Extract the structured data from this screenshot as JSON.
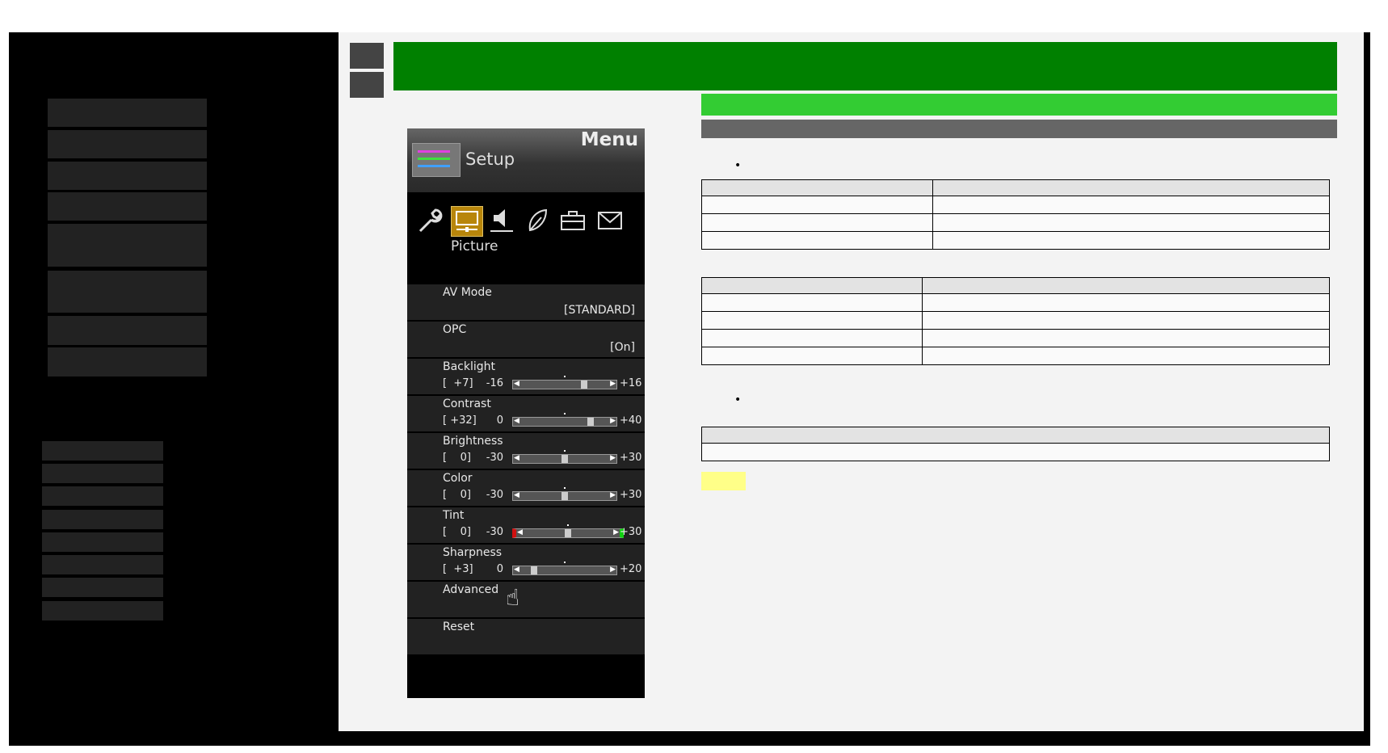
{
  "tv_menu": {
    "menu_label": "Menu",
    "setup_label": "Setup",
    "category_label": "Picture",
    "category_icons": [
      "wrench-icon",
      "picture-icon",
      "speaker-icon",
      "leaf-icon",
      "briefcase-icon",
      "mail-icon"
    ],
    "items": [
      {
        "label": "AV Mode",
        "value": "[STANDARD]"
      },
      {
        "label": "OPC",
        "value": "[On]"
      },
      {
        "label": "Backlight",
        "current": "+7",
        "min": "-16",
        "max": "+16",
        "level": 0.72
      },
      {
        "label": "Contrast",
        "current": "+32",
        "min": "0",
        "max": "+40",
        "level": 0.8
      },
      {
        "label": "Brightness",
        "current": "0",
        "min": "-30",
        "max": "+30",
        "level": 0.5
      },
      {
        "label": "Color",
        "current": "0",
        "min": "-30",
        "max": "+30",
        "level": 0.5
      },
      {
        "label": "Tint",
        "current": "0",
        "min": "-30",
        "max": "+30",
        "level": 0.5
      },
      {
        "label": "Sharpness",
        "current": "+3",
        "min": "0",
        "max": "+20",
        "level": 0.15
      },
      {
        "label": "Advanced"
      },
      {
        "label": "Reset"
      }
    ]
  },
  "content": {
    "bullet": "•"
  },
  "colors": {
    "title_bar": "#008000",
    "sub_bar": "#33cc33",
    "highlight": "#ffff88"
  }
}
